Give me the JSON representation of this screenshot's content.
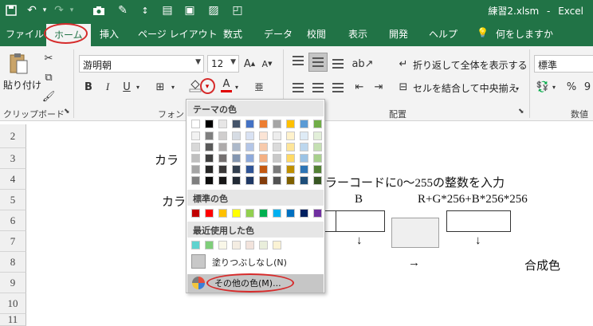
{
  "titlebar": {
    "filename": "練習2.xlsm",
    "separator": "-",
    "app": "Excel",
    "qat_icons": [
      "save-icon",
      "undo-icon",
      "undo-dropdown-icon",
      "redo-icon",
      "camera-icon",
      "format-painter-icon",
      "sort-icon",
      "form-icon",
      "window-icon",
      "image-icon",
      "shape-icon"
    ]
  },
  "tabs": [
    "ファイル",
    "ホーム",
    "挿入",
    "ページ レイアウト",
    "数式",
    "データ",
    "校閲",
    "表示",
    "開発",
    "ヘルプ",
    "何をしますか"
  ],
  "tell_me_icon": "lightbulb-icon",
  "ribbon": {
    "clipboard": {
      "paste_label": "貼り付け",
      "group_label": "クリップボード",
      "icons": [
        "cut-icon",
        "copy-icon",
        "format-painter-icon"
      ]
    },
    "font": {
      "font_name": "游明朝",
      "font_size": "12",
      "grow_label": "A",
      "shrink_label": "A",
      "bold": "B",
      "italic": "I",
      "underline": "U",
      "font_color_letter": "A",
      "phonetic_label": "亜",
      "group_label": "フォント"
    },
    "alignment": {
      "wrap_text": "折り返して全体を表示する",
      "merge_center": "セルを結合して中央揃え",
      "group_label": "配置"
    },
    "number": {
      "format": "標準",
      "percent": "%",
      "comma": "9",
      "group_label": "数値"
    }
  },
  "sheet": {
    "row_headers": [
      "2",
      "3",
      "4",
      "5",
      "6",
      "7",
      "8",
      "9",
      "10",
      "11"
    ],
    "texts": {
      "r3": "カラ",
      "r4": "ラーコードに0〜255の整数を入力",
      "r5a": "カラ",
      "r5b": "B",
      "r5c": "R+G*256+B*256*256",
      "r7a": "↓",
      "r7b": "↓",
      "r8a": "→",
      "r8b": "合成色"
    }
  },
  "color_popup": {
    "theme_header": "テーマの色",
    "standard_header": "標準の色",
    "recent_header": "最近使用した色",
    "no_fill": "塗りつぶしなし(N)",
    "more_colors": "その他の色(M)...",
    "theme_rows": [
      [
        "#ffffff",
        "#000000",
        "#e7e6e6",
        "#44546a",
        "#4472c4",
        "#ed7d31",
        "#a5a5a5",
        "#ffc000",
        "#5b9bd5",
        "#70ad47"
      ],
      [
        "#f2f2f2",
        "#7f7f7f",
        "#d0cece",
        "#d6dce4",
        "#d9e2f3",
        "#fbe4d5",
        "#ededed",
        "#fff2cc",
        "#deebf6",
        "#e2efd9"
      ],
      [
        "#d8d8d8",
        "#595959",
        "#aeabab",
        "#adb9ca",
        "#b4c6e7",
        "#f7caac",
        "#dbdbdb",
        "#fee599",
        "#bdd7ee",
        "#c5e0b3"
      ],
      [
        "#bfbfbf",
        "#3f3f3f",
        "#757070",
        "#8496b0",
        "#8eaadb",
        "#f4b083",
        "#c9c9c9",
        "#ffd965",
        "#9cc3e5",
        "#a8d08d"
      ],
      [
        "#a5a5a5",
        "#262626",
        "#3a3838",
        "#323f4f",
        "#2f5496",
        "#c45911",
        "#7b7b7b",
        "#bf8f00",
        "#2e75b5",
        "#538135"
      ],
      [
        "#7f7f7f",
        "#0c0c0c",
        "#171616",
        "#222a35",
        "#1f3864",
        "#833c0b",
        "#525252",
        "#7f6000",
        "#1e4e79",
        "#375623"
      ]
    ],
    "standard_colors": [
      "#c00000",
      "#ff0000",
      "#ffc000",
      "#ffff00",
      "#92d050",
      "#00b050",
      "#00b0f0",
      "#0070c0",
      "#002060",
      "#7030a0"
    ],
    "recent_colors": [
      "#5fd3cf",
      "#7fce7a",
      "#f9f7e8",
      "#f4ede2",
      "#f2e3dc",
      "#e9eedb",
      "#fbf3d4"
    ]
  },
  "annotation_color": "#d62b2b"
}
